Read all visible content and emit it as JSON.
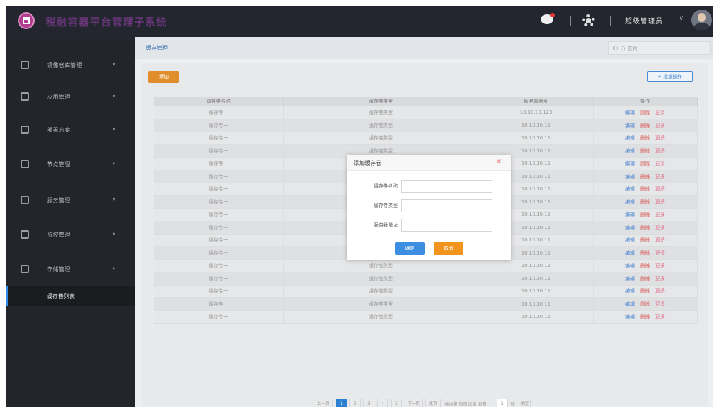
{
  "header": {
    "app_title": "税融容器平台管理子系统",
    "user_name": "超级管理员",
    "avatar_icon": "user-avatar",
    "chat_icon": "chat-icon",
    "settings_icon": "gear-icon",
    "accent": "#8a3f9e"
  },
  "sidebar": {
    "items": [
      {
        "label": "镜像仓库管理",
        "icon": "home-icon",
        "arrow": "▸"
      },
      {
        "label": "应用管理",
        "icon": "folder-icon",
        "arrow": "▸"
      },
      {
        "label": "部署方案",
        "icon": "list-icon",
        "arrow": "▸"
      },
      {
        "label": "节点管理",
        "icon": "node-icon",
        "arrow": "▸"
      },
      {
        "label": "服务管理",
        "icon": "service-icon",
        "arrow": "▾"
      },
      {
        "label": "监控管理",
        "icon": "monitor-icon",
        "arrow": "▸"
      },
      {
        "label": "存储管理",
        "icon": "storage-icon",
        "arrow": "▸"
      }
    ],
    "active_sub": "缓存卷列表"
  },
  "breadcrumb": {
    "label": "缓存管理"
  },
  "search": {
    "placeholder": "Q 查找..."
  },
  "toolbar": {
    "add_label": "添加",
    "batch_label": "+ 批量操作"
  },
  "table": {
    "columns": [
      "缓存卷名称",
      "缓存卷类型",
      "服务器地址",
      "操作"
    ],
    "rows": [
      [
        "缓存卷一",
        "缓存卷类型",
        "10.10.10.123"
      ],
      [
        "缓存卷一",
        "缓存卷类型",
        "10.10.10.11"
      ],
      [
        "缓存卷一",
        "缓存卷类型",
        "10.10.10.11"
      ],
      [
        "缓存卷一",
        "缓存卷类型",
        "10.10.10.11"
      ],
      [
        "缓存卷一",
        "缓存卷类型",
        "10.10.10.11"
      ],
      [
        "缓存卷一",
        "缓存卷类型",
        "10.10.10.11"
      ],
      [
        "缓存卷一",
        "缓存卷类型",
        "10.10.10.11"
      ],
      [
        "缓存卷一",
        "缓存卷类型",
        "10.10.10.11"
      ],
      [
        "缓存卷一",
        "缓存卷类型",
        "10.10.10.11"
      ],
      [
        "缓存卷一",
        "缓存卷类型",
        "10.10.10.11"
      ],
      [
        "缓存卷一",
        "缓存卷类型",
        "10.10.10.11"
      ],
      [
        "缓存卷一",
        "缓存卷类型",
        "10.10.10.11"
      ],
      [
        "缓存卷一",
        "缓存卷类型",
        "10.10.10.11"
      ],
      [
        "缓存卷一",
        "缓存卷类型",
        "10.10.10.11"
      ],
      [
        "缓存卷一",
        "缓存卷类型",
        "10.10.10.11"
      ],
      [
        "缓存卷一",
        "缓存卷类型",
        "10.10.10.11"
      ],
      [
        "缓存卷一",
        "缓存卷类型",
        "10.10.10.11"
      ]
    ],
    "actions": {
      "edit": "编辑",
      "delete": "删除",
      "more": "更多"
    }
  },
  "pagination": {
    "prev": "上一页",
    "pages": [
      "1",
      "2",
      "3",
      "4",
      "5"
    ],
    "next": "下一页",
    "last": "尾页",
    "summary": "共80条 每页20条 到第",
    "page_input": "1",
    "page_unit": "页",
    "go": "确定"
  },
  "modal": {
    "title": "添加缓存卷",
    "close": "×",
    "fields": [
      {
        "label": "缓存卷名称",
        "value": "",
        "placeholder": ""
      },
      {
        "label": "缓存卷类型",
        "value": "",
        "placeholder": ""
      },
      {
        "label": "服务器地址",
        "value": "",
        "placeholder": ""
      }
    ],
    "confirm": "确定",
    "cancel": "取消"
  }
}
